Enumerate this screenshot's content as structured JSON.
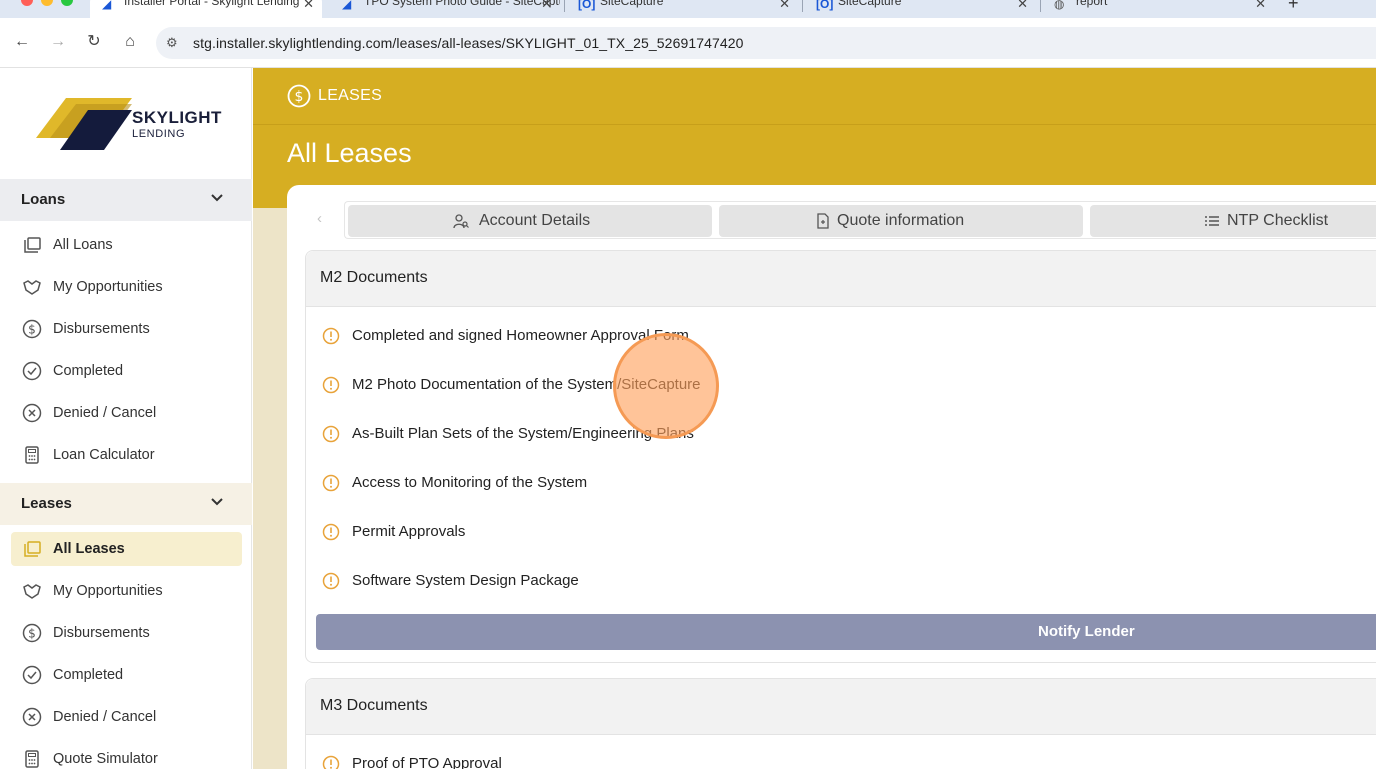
{
  "browser": {
    "tabs": [
      {
        "title": "Installer Portal - Skylight Lending",
        "favicon": "skylight-logo-icon",
        "active": true
      },
      {
        "title": "TPO System Photo Guide - SiteCapture",
        "favicon": "skylight-logo-icon",
        "active": false
      },
      {
        "title": "SiteCapture",
        "favicon": "sitecapture-icon",
        "active": false
      },
      {
        "title": "SiteCapture",
        "favicon": "sitecapture-icon",
        "active": false
      },
      {
        "title": "report",
        "favicon": "globe-icon",
        "active": false
      }
    ],
    "url": "stg.installer.skylightlending.com/leases/all-leases/SKYLIGHT_01_TX_25_52691747420"
  },
  "brand": {
    "name_line1": "SKYLIGHT",
    "name_line2": "LENDING",
    "accent_color": "#d6ae22"
  },
  "sidebar": {
    "loans": {
      "title": "Loans",
      "items": [
        {
          "label": "All Loans",
          "icon": "folders-icon"
        },
        {
          "label": "My Opportunities",
          "icon": "handshake-icon"
        },
        {
          "label": "Disbursements",
          "icon": "dollar-circle-icon"
        },
        {
          "label": "Completed",
          "icon": "check-circle-icon"
        },
        {
          "label": "Denied / Cancel",
          "icon": "x-circle-icon"
        },
        {
          "label": "Loan Calculator",
          "icon": "calculator-icon"
        }
      ]
    },
    "leases": {
      "title": "Leases",
      "items": [
        {
          "label": "All Leases",
          "icon": "folders-icon",
          "active": true
        },
        {
          "label": "My Opportunities",
          "icon": "handshake-icon"
        },
        {
          "label": "Disbursements",
          "icon": "dollar-circle-icon"
        },
        {
          "label": "Completed",
          "icon": "check-circle-icon"
        },
        {
          "label": "Denied / Cancel",
          "icon": "x-circle-icon"
        },
        {
          "label": "Quote Simulator",
          "icon": "calculator-icon"
        }
      ]
    }
  },
  "header": {
    "section_label": "LEASES",
    "section_icon": "dollar-circle-icon",
    "title": "All Leases"
  },
  "detail_tabs": [
    {
      "label": "Account Details",
      "icon": "user-search-icon"
    },
    {
      "label": "Quote information",
      "icon": "document-icon"
    },
    {
      "label": "NTP Checklist",
      "icon": "list-icon"
    }
  ],
  "m2": {
    "title": "M2 Documents",
    "items": [
      "Completed and signed Homeowner Approval Form",
      "M2 Photo Documentation of the System/SiteCapture",
      "As-Built Plan Sets of the System/Engineering Plans",
      "Access to Monitoring of the System",
      "Permit Approvals",
      "Software System Design Package"
    ],
    "status_icon": "warning-circle-icon",
    "status_color": "#e8a33a",
    "notify_label": "Notify Lender"
  },
  "m3": {
    "title": "M3 Documents",
    "items": [
      "Proof of PTO Approval"
    ]
  }
}
